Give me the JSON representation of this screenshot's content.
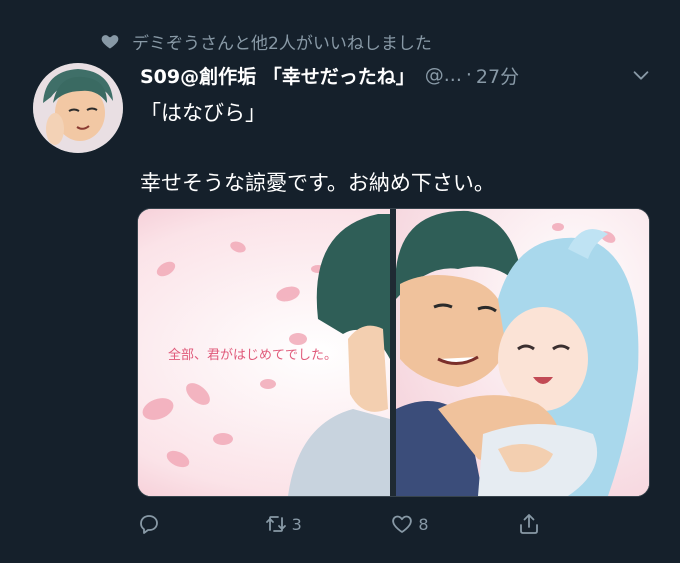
{
  "social_context": {
    "text": "デミぞうさんと他2人がいいねしました"
  },
  "tweet": {
    "display_name": "S09@創作垢 「幸せだったね」",
    "handle": "@...",
    "dot": "·",
    "time": "27分",
    "text_line1": "「はなびら」",
    "text_line2": "幸せそうな諒憂です。お納め下さい。"
  },
  "media": {
    "caption": "全部、君がはじめてでした。"
  },
  "actions": {
    "reply_count": "",
    "retweet_count": "3",
    "like_count": "8"
  },
  "colors": {
    "background": "#15202b",
    "secondary_text": "#8899a6",
    "primary_text": "#ffffff"
  },
  "icons": [
    "heart-icon",
    "chevron-down-icon",
    "reply-icon",
    "retweet-icon",
    "like-icon",
    "share-icon"
  ]
}
